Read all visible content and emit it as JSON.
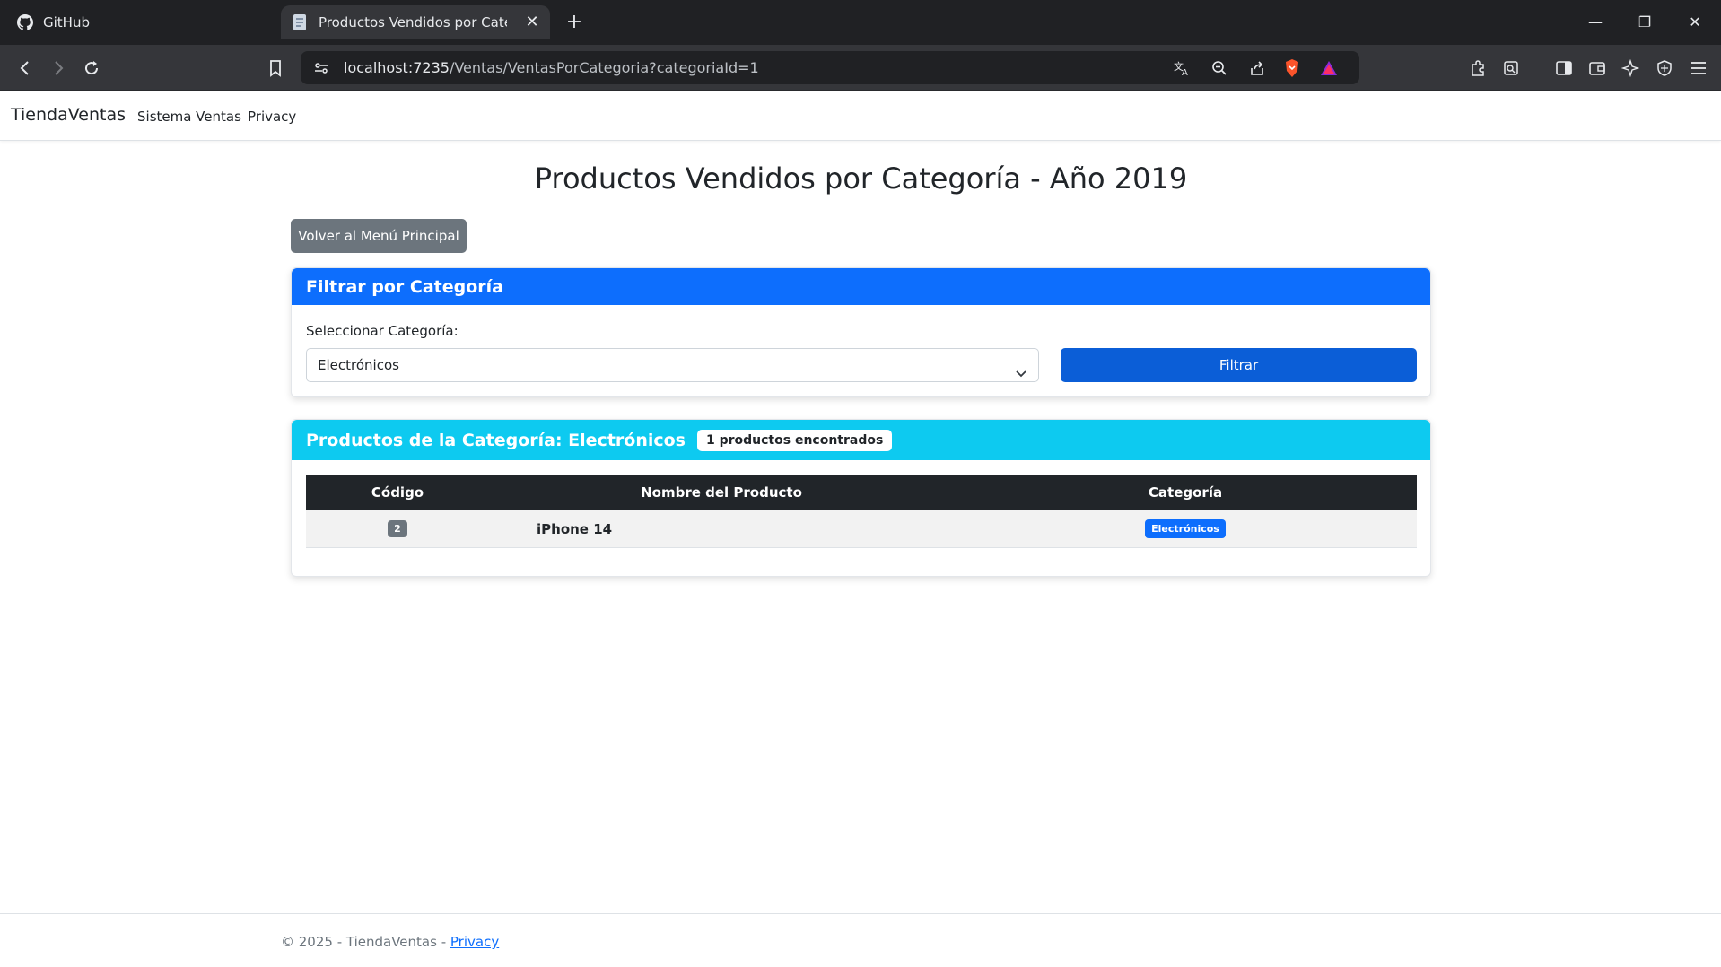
{
  "browser": {
    "tabs": [
      {
        "title": "GitHub",
        "icon": "github-icon",
        "active": false
      },
      {
        "title": "Productos Vendidos por Categoría - TiendaVentas",
        "icon": "page-icon",
        "active": true
      }
    ],
    "url_host": "localhost:7235",
    "url_path": "/Ventas/VentasPorCategoria?categoriaId=1"
  },
  "navbar": {
    "brand": "TiendaVentas",
    "links": [
      "Sistema Ventas",
      "Privacy"
    ]
  },
  "page": {
    "title": "Productos Vendidos por Categoría - Año 2019",
    "back_button": "Volver al Menú Principal"
  },
  "filter": {
    "header": "Filtrar por Categoría",
    "label": "Seleccionar Categoría:",
    "selected": "Electrónicos",
    "button": "Filtrar"
  },
  "products": {
    "header_prefix": "Productos de la Categoría:",
    "header_category": "Electrónicos",
    "count_badge": "1 productos encontrados",
    "columns": [
      "Código",
      "Nombre del Producto",
      "Categoría"
    ],
    "rows": [
      {
        "code": "2",
        "name": "iPhone 14",
        "category": "Electrónicos"
      }
    ]
  },
  "footer": {
    "text": "© 2025 - TiendaVentas - ",
    "link": "Privacy"
  },
  "colors": {
    "primary": "#0d6efd",
    "info": "#0dcaf0",
    "secondary": "#6c757d",
    "dark": "#212529"
  }
}
